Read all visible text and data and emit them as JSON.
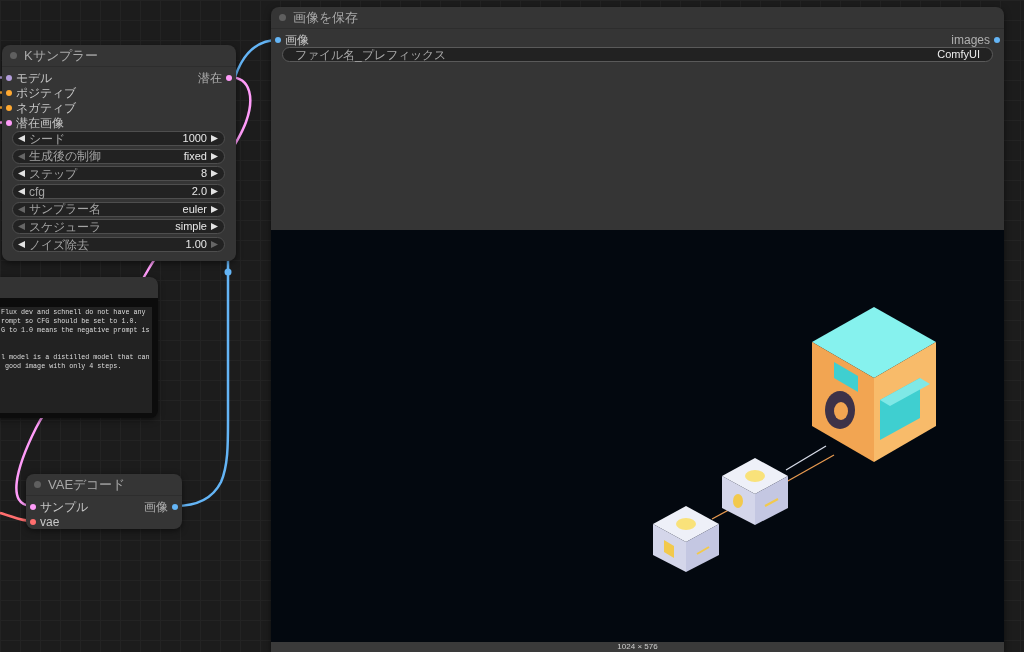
{
  "ksampler": {
    "title": "Kサンプラー",
    "inputs": [
      {
        "label": "モデル",
        "color": "#b39ddb"
      },
      {
        "label": "ポジティブ",
        "color": "#ffa931"
      },
      {
        "label": "ネガティブ",
        "color": "#ffa931"
      },
      {
        "label": "潜在画像",
        "color": "#ff9cf9"
      }
    ],
    "outputs": [
      {
        "label": "潜在",
        "color": "#ff9cf9"
      }
    ],
    "widgets": [
      {
        "label": "シード",
        "value": "1000",
        "left_enabled": true,
        "right_enabled": true
      },
      {
        "label": "生成後の制御",
        "value": "fixed",
        "left_enabled": false,
        "right_enabled": true
      },
      {
        "label": "ステップ",
        "value": "8",
        "left_enabled": true,
        "right_enabled": true
      },
      {
        "label": "cfg",
        "value": "2.0",
        "left_enabled": true,
        "right_enabled": true
      },
      {
        "label": "サンプラー名",
        "value": "euler",
        "left_enabled": false,
        "right_enabled": true
      },
      {
        "label": "スケジューラ",
        "value": "simple",
        "left_enabled": false,
        "right_enabled": true
      },
      {
        "label": "ノイズ除去",
        "value": "1.00",
        "left_enabled": true,
        "right_enabled": false
      }
    ]
  },
  "note": {
    "text": "Flux dev and schnell do not have any\nrompt so CFG should be set to 1.0.\nG to 1.0 means the negative prompt is\n\n\nl model is a distilled model that can\n good image with only 4 steps."
  },
  "vae_decode": {
    "title": "VAEデコード",
    "inputs": [
      {
        "label": "サンプル",
        "color": "#ff9cf9"
      },
      {
        "label": "vae",
        "color": "#ff6e6e"
      }
    ],
    "outputs": [
      {
        "label": "画像",
        "color": "#64b5f6"
      }
    ]
  },
  "save_image": {
    "title": "画像を保存",
    "inputs": [
      {
        "label": "画像",
        "color": "#64b5f6"
      }
    ],
    "outputs": [
      {
        "label": "images",
        "color": "#64b5f6"
      }
    ],
    "widget": {
      "label": "ファイル名_プレフィックス",
      "value": "ComfyUI"
    },
    "image_size": "1024 × 576"
  }
}
